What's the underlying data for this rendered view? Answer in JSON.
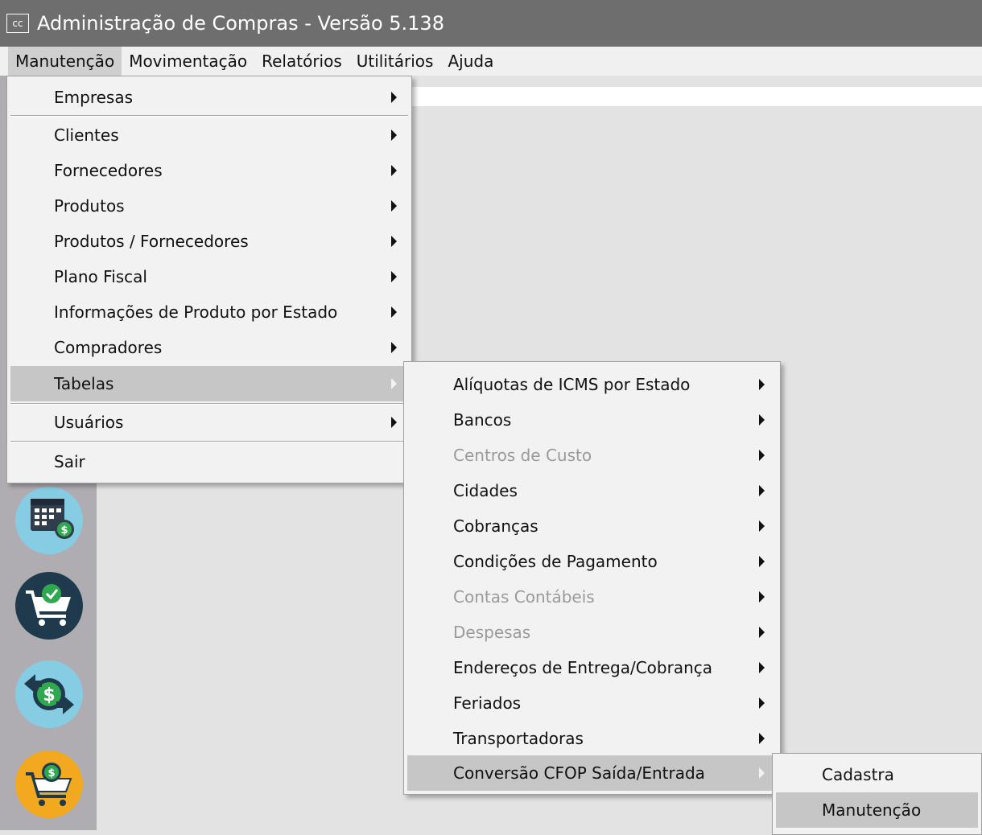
{
  "window": {
    "title": "Administração de Compras - Versão 5.138",
    "icon_text": "cc"
  },
  "menubar": [
    "Manutenção",
    "Movimentação",
    "Relatórios",
    "Utilitários",
    "Ajuda"
  ],
  "menu1": {
    "items": [
      "Empresas",
      "Clientes",
      "Fornecedores",
      "Produtos",
      "Produtos / Fornecedores",
      "Plano Fiscal",
      "Informações de Produto por Estado",
      "Compradores",
      "Tabelas",
      "Usuários",
      "Sair"
    ],
    "highlighted": "Tabelas"
  },
  "menu2": {
    "items": [
      "Alíquotas de ICMS por Estado",
      "Bancos",
      "Centros de Custo",
      "Cidades",
      "Cobranças",
      "Condições de Pagamento",
      "Contas Contábeis",
      "Despesas",
      "Endereços de Entrega/Cobrança",
      "Feriados",
      "Transportadoras",
      "Conversão CFOP Saída/Entrada"
    ],
    "disabled": [
      "Centros de Custo",
      "Contas Contábeis",
      "Despesas"
    ],
    "highlighted": "Conversão CFOP Saída/Entrada"
  },
  "menu3": {
    "items": [
      "Cadastra",
      "Manutenção"
    ],
    "highlighted": "Manutenção"
  },
  "sidebar_icons": [
    "calendar-money-icon",
    "cart-check-icon",
    "money-exchange-icon",
    "cart-money-icon"
  ],
  "colors": {
    "titlebar": "#6e6e6e",
    "menu_highlight": "#c6c6c6",
    "sidebar": "#b0adb2"
  }
}
